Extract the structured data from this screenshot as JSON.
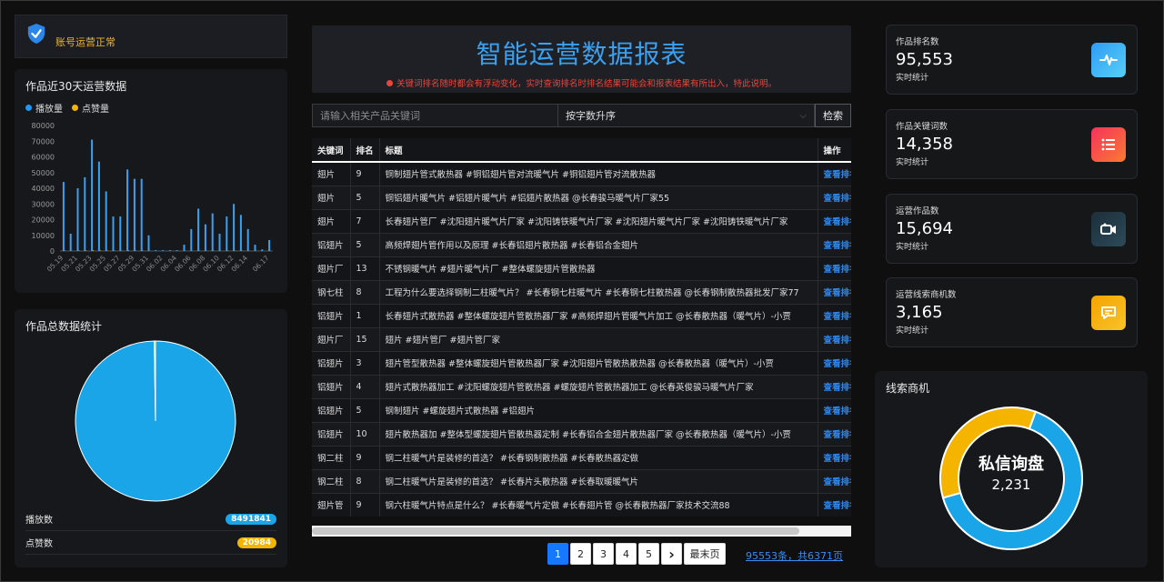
{
  "status": {
    "text": "账号运营正常"
  },
  "trend": {
    "title": "作品近30天运营数据",
    "legend": [
      {
        "label": "播放量",
        "color": "#2196f3"
      },
      {
        "label": "点赞量",
        "color": "#f5b400"
      }
    ]
  },
  "chart_data": {
    "type": "bar",
    "categories": [
      "05.19",
      "05.20",
      "05.21",
      "05.22",
      "05.23",
      "05.24",
      "05.25",
      "05.26",
      "05.27",
      "05.28",
      "05.29",
      "05.30",
      "05.31",
      "06.01",
      "06.02",
      "06.03",
      "06.04",
      "06.05",
      "06.06",
      "06.07",
      "06.08",
      "06.09",
      "06.10",
      "06.11",
      "06.12",
      "06.13",
      "06.14",
      "06.15",
      "06.16",
      "06.17"
    ],
    "tick_labels": [
      "05.19",
      "05.21",
      "05.23",
      "05.25",
      "05.27",
      "05.29",
      "05.31",
      "06.02",
      "06.04",
      "06.06",
      "06.08",
      "06.10",
      "06.12",
      "06.14",
      "06.17"
    ],
    "series": [
      {
        "name": "播放量",
        "color": "#3aa0f0",
        "values": [
          44000,
          11000,
          40000,
          47000,
          71000,
          57000,
          38000,
          22000,
          22000,
          52000,
          46000,
          46000,
          10000,
          500,
          500,
          500,
          500,
          4000,
          14000,
          27000,
          17000,
          24000,
          11000,
          22000,
          30000,
          23000,
          14000,
          4000,
          1000,
          7000
        ]
      },
      {
        "name": "点赞量",
        "color": "#f5b400",
        "values": [
          300,
          100,
          300,
          300,
          500,
          400,
          300,
          200,
          200,
          400,
          300,
          300,
          100,
          0,
          0,
          0,
          0,
          100,
          100,
          200,
          100,
          200,
          100,
          200,
          200,
          200,
          100,
          100,
          0,
          100
        ]
      }
    ],
    "yticks": [
      0,
      10000,
      20000,
      30000,
      40000,
      50000,
      60000,
      70000,
      80000
    ],
    "ylim": [
      0,
      80000
    ]
  },
  "totals": {
    "title": "作品总数据统计",
    "rows": [
      {
        "label": "播放数",
        "value": "8491841",
        "color": "#1aa5e8"
      },
      {
        "label": "点赞数",
        "value": "20984",
        "color": "#f5b400"
      }
    ],
    "pie": [
      8491841,
      20984
    ]
  },
  "header": {
    "title": "智能运营数据报表",
    "note": "关键词排名随时都会有浮动变化，实时查询排名时排名结果可能会和报表结果有所出入，特此说明。"
  },
  "search": {
    "placeholder": "请输入相关产品关键词",
    "sort": "按字数升序",
    "button": "检索"
  },
  "table": {
    "headers": [
      "关键词",
      "排名",
      "标题",
      "操作"
    ],
    "op_label": "查看排名",
    "rows": [
      [
        "翅片",
        "9",
        "铜制翅片管式散热器 #铜铝翅片管对流暖气片 #铜铝翅片管对流散热器"
      ],
      [
        "翅片",
        "5",
        "铜铝翅片暖气片 #铝翅片暖气片 #铝翅片散热器 @长春骏马暖气片厂家55"
      ],
      [
        "翅片",
        "7",
        "长春翅片管厂 #沈阳翅片暖气片厂家 #沈阳铸铁暖气片厂家 #沈阳翅片暖气片厂家 #沈阳铸铁暖气片厂家"
      ],
      [
        "铝翅片",
        "5",
        "高频焊翅片管作用以及原理 #长春铝翅片散热器 #长春铝合金翅片"
      ],
      [
        "翅片厂",
        "13",
        "不锈钢暖气片 #翅片暖气片厂 #整体螺旋翅片管散热器"
      ],
      [
        "钢七柱",
        "8",
        "工程为什么要选择钢制二柱暖气片？ #长春钢七柱暖气片 #长春钢七柱散热器 @长春钢制散热器批发厂家77"
      ],
      [
        "铝翅片",
        "1",
        "长春翅片式散热器 #整体螺旋翅片管散热器厂家 #高频焊翅片管暖气片加工 @长春散热器（暖气片）-小贾"
      ],
      [
        "翅片厂",
        "15",
        "翅片 #翅片管厂 #翅片管厂家"
      ],
      [
        "铝翅片",
        "3",
        "翅片管型散热器 #整体螺旋翅片管散热器厂家 #沈阳翅片管散热散热器 @长春散热器（暖气片）-小贾"
      ],
      [
        "铝翅片",
        "4",
        "翅片式散热器加工 #沈阳螺旋翅片管散热器 #螺旋翅片管散热器加工 @长春英俊骏马暖气片厂家"
      ],
      [
        "铝翅片",
        "5",
        "钢制翅片 #螺旋翅片式散热器 #铝翅片"
      ],
      [
        "铝翅片",
        "10",
        "翅片散热器加 #整体型螺旋翅片管散热器定制 #长春铝合金翅片散热器厂家 @长春散热器（暖气片）-小贾"
      ],
      [
        "钢二柱",
        "9",
        "钢二柱暖气片是装修的首选？ #长春钢制散热器 #长春散热器定做"
      ],
      [
        "钢二柱",
        "8",
        "钢二柱暖气片是装修的首选？ #长春片头散热器 #长春取暖暖气片"
      ],
      [
        "翅片管",
        "9",
        "钢六柱暖气片特点是什么？ #长春暖气片定做 #长春翅片管 @长春散热器厂家技术交流88"
      ]
    ]
  },
  "pager": {
    "pages": [
      "1",
      "2",
      "3",
      "4",
      "5"
    ],
    "next": "›",
    "last": "最末页",
    "total": "95553条，共6371页"
  },
  "kpis": [
    {
      "label": "作品排名数",
      "value": "95,553",
      "sub": "实时统计",
      "icon": "pulse-icon",
      "colors": [
        "#2f9cf5",
        "#56d0f7"
      ]
    },
    {
      "label": "作品关键词数",
      "value": "14,358",
      "sub": "实时统计",
      "icon": "list-icon",
      "colors": [
        "#f5325c",
        "#fa7a32"
      ]
    },
    {
      "label": "运营作品数",
      "value": "15,694",
      "sub": "实时统计",
      "icon": "video-icon",
      "colors": [
        "#1c2f3a",
        "#2d4a5a"
      ]
    },
    {
      "label": "运营线索商机数",
      "value": "3,165",
      "sub": "实时统计",
      "icon": "message-icon",
      "colors": [
        "#f5a400",
        "#f8c32a"
      ]
    }
  ],
  "leads": {
    "title": "线索商机",
    "center_title": "私信询盘",
    "center_value": "2,231",
    "ring": [
      {
        "value": 65,
        "color": "#1aa5e8"
      },
      {
        "value": 35,
        "color": "#f5b400"
      }
    ]
  }
}
